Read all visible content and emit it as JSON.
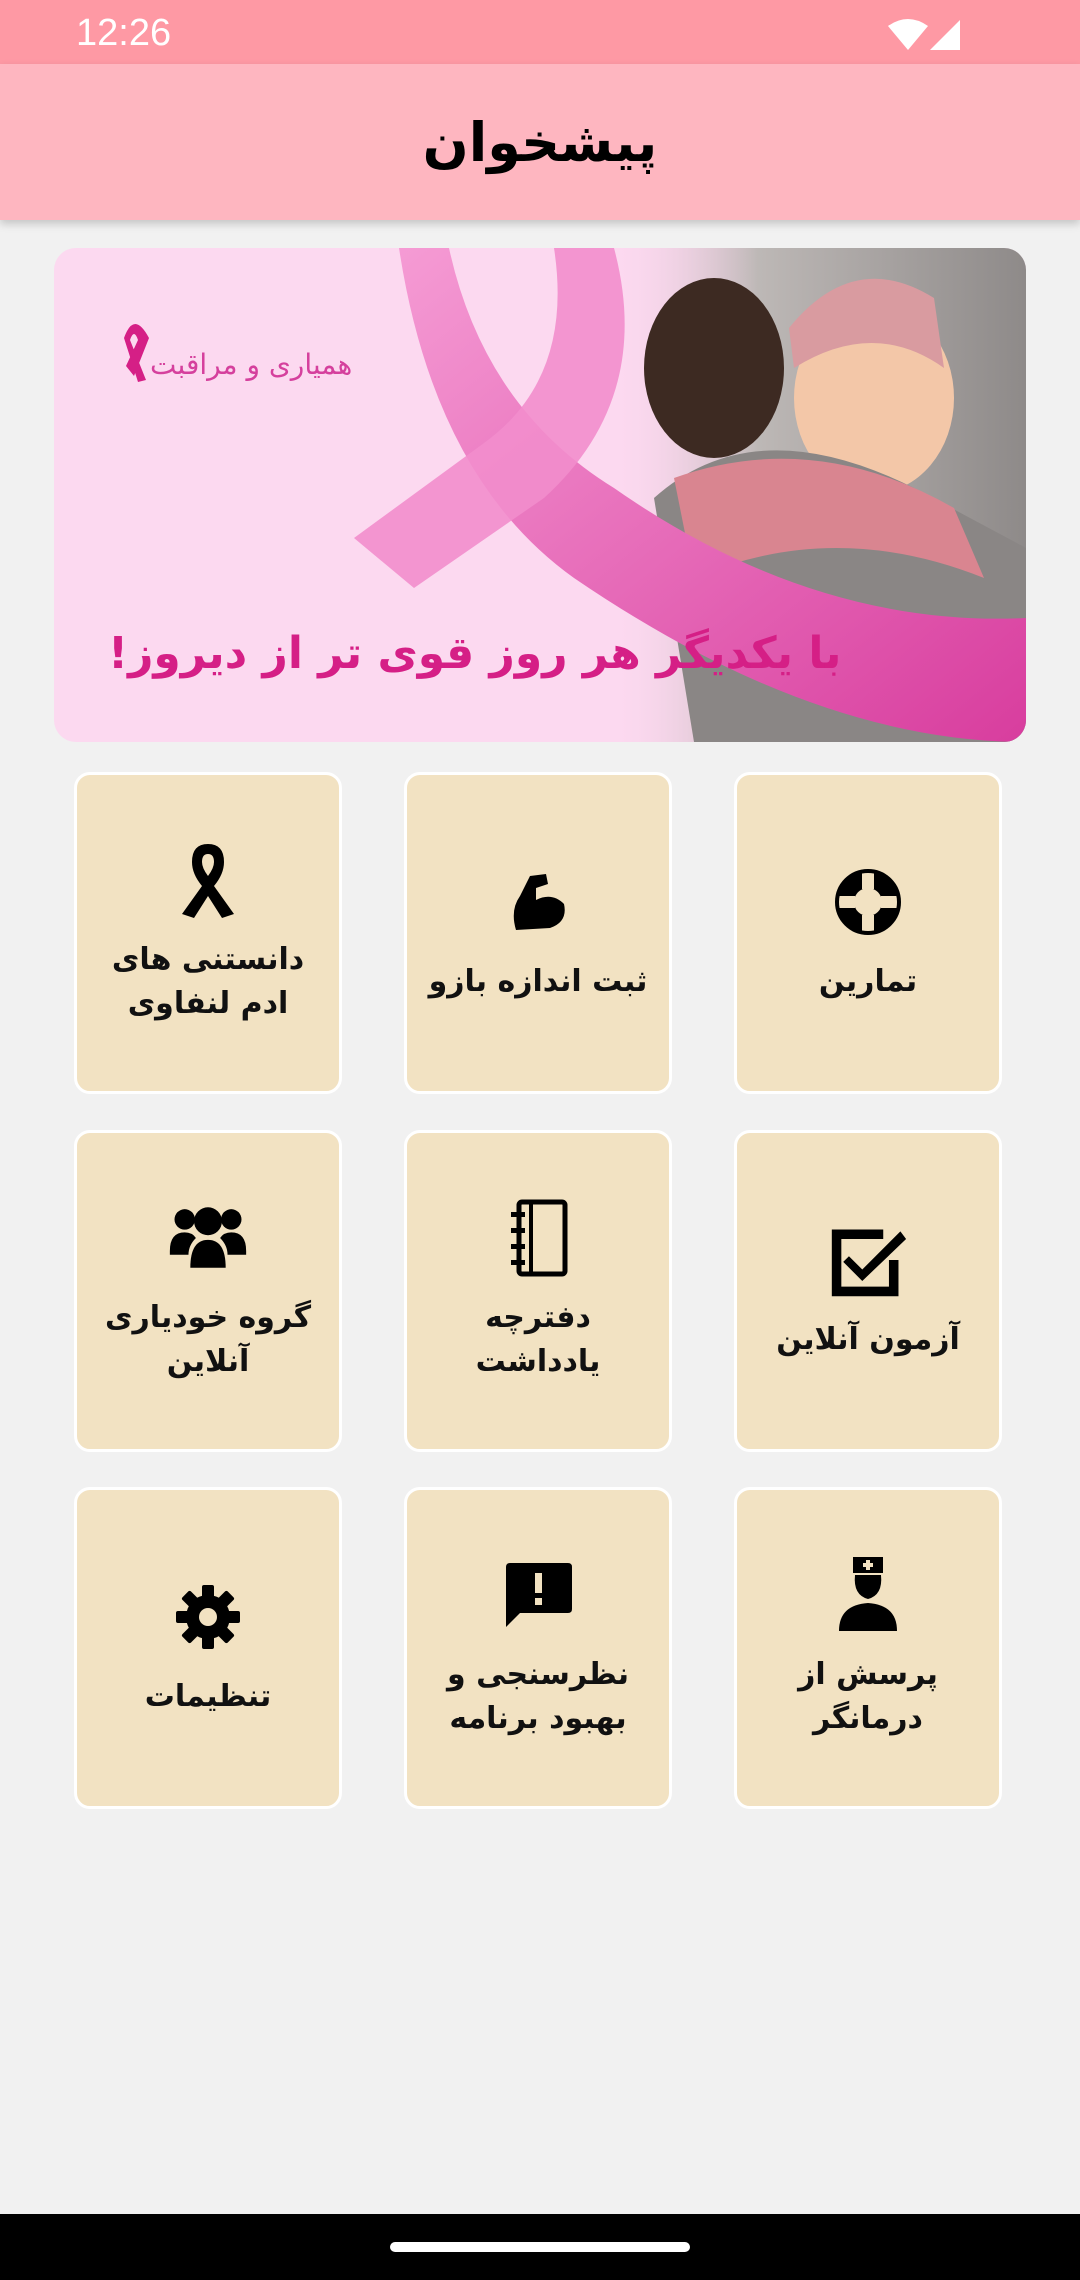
{
  "status_bar": {
    "time": "12:26"
  },
  "app_bar": {
    "title": "پیشخوان"
  },
  "banner": {
    "brand": "همیاری و مراقبت",
    "slogan": "با یکدیگر هر روز قوی تر از دیروز!"
  },
  "tiles": [
    {
      "label": "تمارین",
      "icon": "lifebuoy-icon"
    },
    {
      "label": "ثبت اندازه بازو",
      "icon": "arm-muscle-icon"
    },
    {
      "label": "دانستنی های ادم لنفاوی",
      "icon": "awareness-ribbon-icon"
    },
    {
      "label": "آزمون آنلاین",
      "icon": "checkbox-icon"
    },
    {
      "label": "دفترچه یادداشت",
      "icon": "notebook-icon"
    },
    {
      "label": "گروه خودیاری آنلاین",
      "icon": "group-icon"
    },
    {
      "label": "پرسش از درمانگر",
      "icon": "nurse-icon"
    },
    {
      "label": "نظرسنجی و بهبود برنامه",
      "icon": "feedback-icon"
    },
    {
      "label": "تنظیمات",
      "icon": "gear-icon"
    }
  ],
  "colors": {
    "status_bar": "#fe99a4",
    "app_bar": "#feb6c0",
    "tile": "#f2e2c2",
    "banner_bg": "#fcd9f0",
    "accent_pink": "#d51f86"
  }
}
